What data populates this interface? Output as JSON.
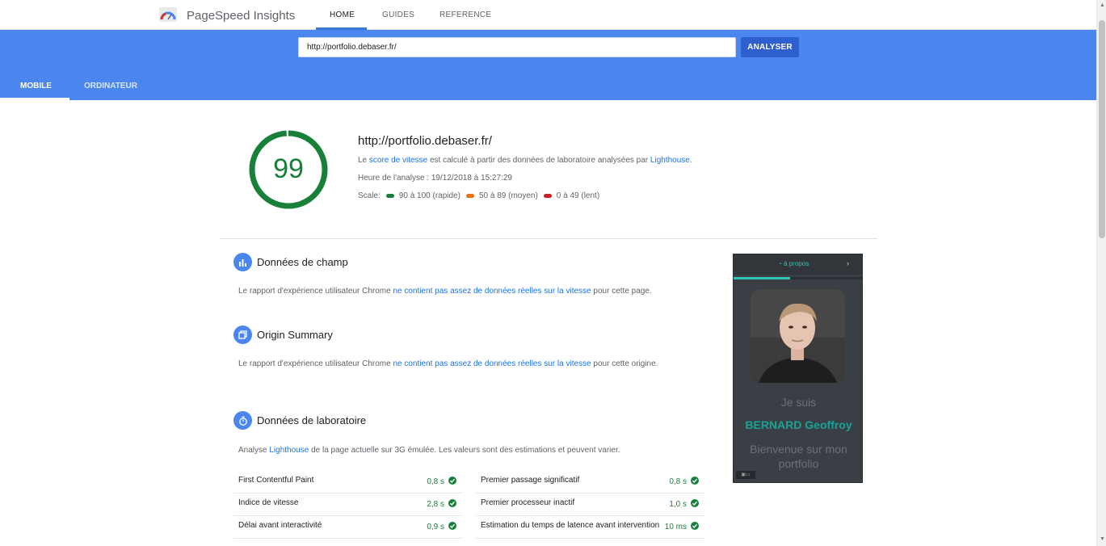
{
  "app": {
    "title": "PageSpeed Insights",
    "logo_icon": "pagespeed-logo-icon",
    "nav": [
      {
        "label": "HOME",
        "active": true
      },
      {
        "label": "GUIDES",
        "active": false
      },
      {
        "label": "REFERENCE",
        "active": false
      }
    ]
  },
  "search": {
    "url_value": "http://portfolio.debaser.fr/",
    "button_label": "ANALYSER"
  },
  "device_tabs": [
    {
      "label": "MOBILE",
      "active": true
    },
    {
      "label": "ORDINATEUR",
      "active": false
    }
  ],
  "summary": {
    "score": "99",
    "score_fraction": 0.99,
    "url": "http://portfolio.debaser.fr/",
    "desc_prefix": "Le ",
    "desc_link1": "score de vitesse",
    "desc_middle": " est calculé à partir des données de laboratoire analysées par ",
    "desc_link2": "Lighthouse",
    "desc_suffix": ".",
    "analysis_time": "Heure de l'analyse : 19/12/2018 à 15:27:29",
    "scale_label": "Scale:",
    "scale": [
      {
        "label": "90 à 100 (rapide)",
        "color": "#188038"
      },
      {
        "label": "50 à 89 (moyen)",
        "color": "#e8710a"
      },
      {
        "label": "0 à 49 (lent)",
        "color": "#c5221f"
      }
    ]
  },
  "sections": {
    "field": {
      "title": "Données de champ",
      "text_prefix": "Le rapport d'expérience utilisateur Chrome ",
      "text_link": "ne contient pas assez de données réelles sur la vitesse",
      "text_suffix": " pour cette page."
    },
    "origin": {
      "title": "Origin Summary",
      "text_prefix": "Le rapport d'expérience utilisateur Chrome ",
      "text_link": "ne contient pas assez de données réelles sur la vitesse",
      "text_suffix": " pour cette origine."
    },
    "lab": {
      "title": "Données de laboratoire",
      "text_prefix": "Analyse ",
      "text_link": "Lighthouse",
      "text_suffix": " de la page actuelle sur 3G émulée. Les valeurs sont des estimations et peuvent varier."
    }
  },
  "metrics": {
    "left": [
      {
        "name": "First Contentful Paint",
        "value": "0,8 s"
      },
      {
        "name": "Indice de vitesse",
        "value": "2,8 s"
      },
      {
        "name": "Délai avant interactivité",
        "value": "0,9 s"
      }
    ],
    "right": [
      {
        "name": "Premier passage significatif",
        "value": "0,8 s"
      },
      {
        "name": "Premier processeur inactif",
        "value": "1,0 s"
      },
      {
        "name": "Estimation du temps de latence avant intervention",
        "value": "10 ms"
      }
    ]
  },
  "thumbnail": {
    "menu_label": "à propos",
    "greeting": "Je suis",
    "name": "BERNARD Geoffroy",
    "welcome": "Bienvenue sur mon portfolio"
  },
  "colors": {
    "accent": "#4a86ee",
    "button": "#2d5fcf",
    "pass": "#188038",
    "link": "#1a73e8"
  }
}
